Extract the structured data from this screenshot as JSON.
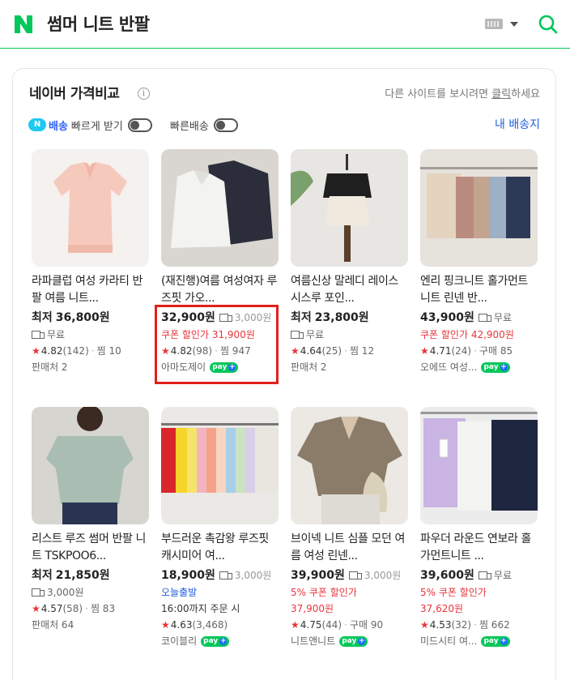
{
  "search": {
    "query": "썸머 니트 반팔"
  },
  "colors": {
    "naver_green": "#03c75a",
    "coupon_red": "#e8353b",
    "link_blue": "#1f5ddf",
    "highlight": "#e0201a"
  },
  "section": {
    "title": "네이버 가격비교",
    "note_before": "다른 사이트를 보시려면 ",
    "note_link": "클릭",
    "note_after": "하세요",
    "filter_npay_label": "N",
    "filter_npay_word": "배송",
    "filter_fast_receive": "빠르게 받기",
    "filter_fast_shipping": "빠른배송",
    "my_address": "내 배송지"
  },
  "products": [
    {
      "name": "라파클럽 여성 카라티 반팔 여름 니트...",
      "price_label": "최저",
      "price": "36,800원",
      "shipping": "무료",
      "coupon": "",
      "rating": "4.82",
      "reviews": "(142)",
      "extra": "찜 10",
      "seller": "판매처 2",
      "npay": false
    },
    {
      "name": "(재진행)여름 여성여자 루즈핏 가오...",
      "price_label": "",
      "price": "32,900원",
      "shipping": "3,000원",
      "coupon": "쿠폰 할인가 31,900원",
      "rating": "4.82",
      "reviews": "(98)",
      "extra": "찜 947",
      "seller": "아마도제이",
      "npay": true
    },
    {
      "name": "여름신상 말레디 레이스 시스루 포인...",
      "price_label": "최저",
      "price": "23,800원",
      "shipping": "무료",
      "coupon": "",
      "rating": "4.64",
      "reviews": "(25)",
      "extra": "찜 12",
      "seller": "판매처 2",
      "npay": false
    },
    {
      "name": "엔리 핑크니트 홀가먼트니트 린넨 반...",
      "price_label": "",
      "price": "43,900원",
      "shipping": "무료",
      "coupon": "쿠폰 할인가 42,900원",
      "rating": "4.71",
      "reviews": "(24)",
      "extra": "구매 85",
      "seller": "오에뜨 여성...",
      "npay": true
    },
    {
      "name": "리스트 루즈 썸머 반팔 니트 TSKPOO6...",
      "price_label": "최저",
      "price": "21,850원",
      "shipping": "3,000원",
      "coupon": "",
      "rating": "4.57",
      "reviews": "(58)",
      "extra": "찜 83",
      "seller": "판매처 64",
      "npay": false
    },
    {
      "name": "부드러운 촉감왕 루즈핏 캐시미어 여...",
      "price_label": "",
      "price": "18,900원",
      "shipping": "3,000원",
      "today": "오늘출발",
      "today_note": "16:00까지 주문 시",
      "rating": "4.63",
      "reviews": "(3,468)",
      "extra": "",
      "seller": "코이블리",
      "npay": true
    },
    {
      "name": "브이넥 니트 심플 모던 여름 여성 린넨...",
      "price_label": "",
      "price": "39,900원",
      "shipping": "3,000원",
      "coupon_line1": "5% 쿠폰 할인가",
      "coupon_line2": "37,900원",
      "rating": "4.75",
      "reviews": "(44)",
      "extra": "구매 90",
      "seller": "니트앤니트",
      "npay": true
    },
    {
      "name": "파우더 라운드 연보라 홀가먼트니트 ...",
      "price_label": "",
      "price": "39,600원",
      "shipping": "무료",
      "coupon_line1": "5% 쿠폰 할인가",
      "coupon_line2": "37,620원",
      "rating": "4.53",
      "reviews": "(32)",
      "extra": "찜 662",
      "seller": "미드시티 여...",
      "npay": true
    }
  ],
  "npay_badge": "pay"
}
